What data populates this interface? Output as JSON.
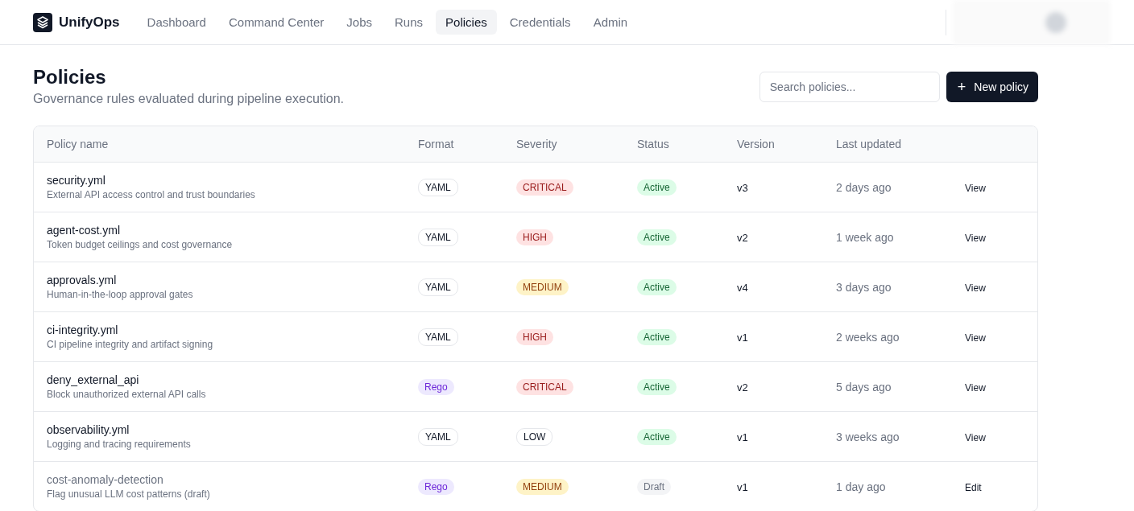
{
  "brand": {
    "name": "UnifyOps"
  },
  "nav": [
    {
      "label": "Dashboard",
      "selected": false
    },
    {
      "label": "Command Center",
      "selected": false
    },
    {
      "label": "Jobs",
      "selected": false
    },
    {
      "label": "Runs",
      "selected": false
    },
    {
      "label": "Policies",
      "selected": true
    },
    {
      "label": "Credentials",
      "selected": false
    },
    {
      "label": "Admin",
      "selected": false
    }
  ],
  "page": {
    "title": "Policies",
    "subtitle": "Governance rules evaluated during pipeline execution."
  },
  "search": {
    "placeholder": "Search policies..."
  },
  "new_button": {
    "icon": "+",
    "label": "New policy"
  },
  "table": {
    "columns": [
      "Policy name",
      "Format",
      "Severity",
      "Status",
      "Version",
      "Last updated"
    ],
    "rows": [
      {
        "name": "security.yml",
        "description": "External API access control and trust boundaries",
        "draft": false,
        "format": {
          "label": "YAML",
          "kind": "yaml"
        },
        "severity": {
          "label": "CRITICAL",
          "kind": "critical"
        },
        "status": {
          "label": "Active",
          "kind": "active"
        },
        "version": "v3",
        "updated": "2 days ago",
        "action": "View"
      },
      {
        "name": "agent-cost.yml",
        "description": "Token budget ceilings and cost governance",
        "draft": false,
        "format": {
          "label": "YAML",
          "kind": "yaml"
        },
        "severity": {
          "label": "HIGH",
          "kind": "high"
        },
        "status": {
          "label": "Active",
          "kind": "active"
        },
        "version": "v2",
        "updated": "1 week ago",
        "action": "View"
      },
      {
        "name": "approvals.yml",
        "description": "Human-in-the-loop approval gates",
        "draft": false,
        "format": {
          "label": "YAML",
          "kind": "yaml"
        },
        "severity": {
          "label": "MEDIUM",
          "kind": "medium"
        },
        "status": {
          "label": "Active",
          "kind": "active"
        },
        "version": "v4",
        "updated": "3 days ago",
        "action": "View"
      },
      {
        "name": "ci-integrity.yml",
        "description": "CI pipeline integrity and artifact signing",
        "draft": false,
        "format": {
          "label": "YAML",
          "kind": "yaml"
        },
        "severity": {
          "label": "HIGH",
          "kind": "high"
        },
        "status": {
          "label": "Active",
          "kind": "active"
        },
        "version": "v1",
        "updated": "2 weeks ago",
        "action": "View"
      },
      {
        "name": "deny_external_api",
        "description": "Block unauthorized external API calls",
        "draft": false,
        "format": {
          "label": "Rego",
          "kind": "rego"
        },
        "severity": {
          "label": "CRITICAL",
          "kind": "critical"
        },
        "status": {
          "label": "Active",
          "kind": "active"
        },
        "version": "v2",
        "updated": "5 days ago",
        "action": "View"
      },
      {
        "name": "observability.yml",
        "description": "Logging and tracing requirements",
        "draft": false,
        "format": {
          "label": "YAML",
          "kind": "yaml"
        },
        "severity": {
          "label": "LOW",
          "kind": "low"
        },
        "status": {
          "label": "Active",
          "kind": "active"
        },
        "version": "v1",
        "updated": "3 weeks ago",
        "action": "View"
      },
      {
        "name": "cost-anomaly-detection",
        "description": "Flag unusual LLM cost patterns (draft)",
        "draft": true,
        "format": {
          "label": "Rego",
          "kind": "rego"
        },
        "severity": {
          "label": "MEDIUM",
          "kind": "medium"
        },
        "status": {
          "label": "Draft",
          "kind": "draft"
        },
        "version": "v1",
        "updated": "1 day ago",
        "action": "Edit"
      }
    ]
  }
}
